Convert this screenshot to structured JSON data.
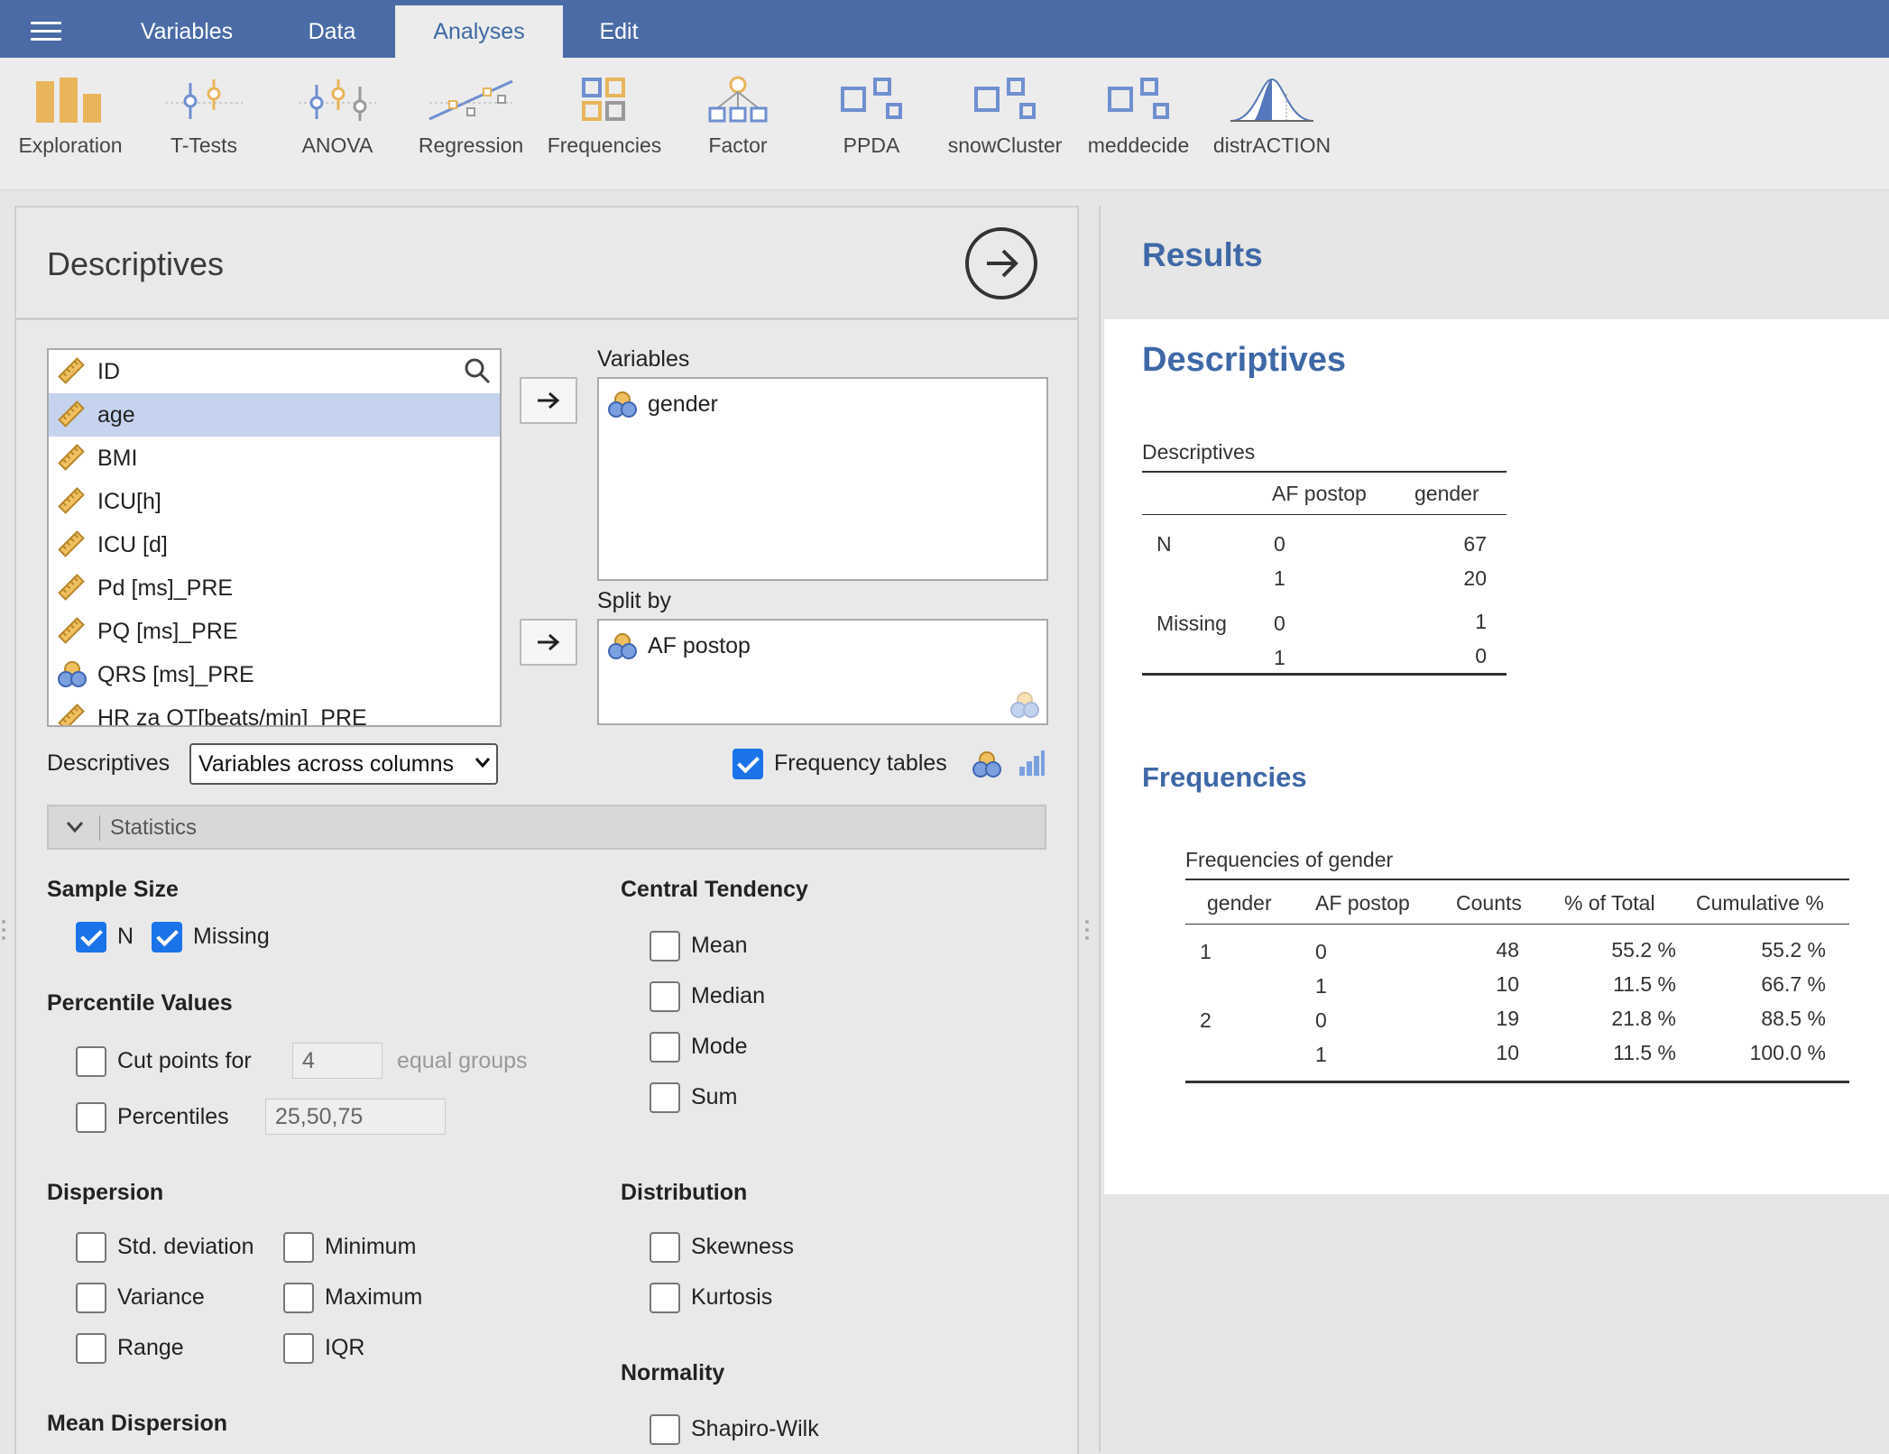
{
  "menu": {
    "tabs": [
      {
        "label": "Variables"
      },
      {
        "label": "Data"
      },
      {
        "label": "Analyses"
      },
      {
        "label": "Edit"
      }
    ],
    "active_tab": "Analyses"
  },
  "ribbon": {
    "items": [
      {
        "label": "Exploration",
        "icon": "exploration-icon"
      },
      {
        "label": "T-Tests",
        "icon": "ttests-icon"
      },
      {
        "label": "ANOVA",
        "icon": "anova-icon"
      },
      {
        "label": "Regression",
        "icon": "regression-icon"
      },
      {
        "label": "Frequencies",
        "icon": "frequencies-icon"
      },
      {
        "label": "Factor",
        "icon": "factor-icon"
      },
      {
        "label": "PPDA",
        "icon": "module-icon"
      },
      {
        "label": "snowCluster",
        "icon": "module-icon"
      },
      {
        "label": "meddecide",
        "icon": "module-icon"
      },
      {
        "label": "distrACTION",
        "icon": "distribution-icon"
      }
    ]
  },
  "options": {
    "title": "Descriptives",
    "variable_list": [
      {
        "name": "ID",
        "type": "continuous"
      },
      {
        "name": "age",
        "type": "continuous",
        "selected": true
      },
      {
        "name": "BMI",
        "type": "continuous"
      },
      {
        "name": "ICU[h]",
        "type": "continuous"
      },
      {
        "name": "ICU [d]",
        "type": "continuous"
      },
      {
        "name": "Pd [ms]_PRE",
        "type": "continuous"
      },
      {
        "name": "PQ [ms]_PRE",
        "type": "continuous"
      },
      {
        "name": "QRS [ms]_PRE",
        "type": "nominal"
      },
      {
        "name": "HR za OT[beats/min]_PRE",
        "type": "continuous"
      }
    ],
    "variables_label": "Variables",
    "variables": [
      "gender"
    ],
    "split_by_label": "Split by",
    "split_by": [
      "AF postop"
    ],
    "descriptives_label": "Descriptives",
    "descriptives_select": "Variables across columns",
    "frequency_tables_label": "Frequency tables",
    "frequency_tables_checked": true,
    "statistics_label": "Statistics",
    "sample_size": {
      "heading": "Sample Size",
      "n_label": "N",
      "n_checked": true,
      "missing_label": "Missing",
      "missing_checked": true
    },
    "percentile_values": {
      "heading": "Percentile Values",
      "cut_points_label": "Cut points for",
      "cut_points_value": "4",
      "equal_groups_label": "equal groups",
      "percentiles_label": "Percentiles",
      "percentiles_value": "25,50,75"
    },
    "dispersion": {
      "heading": "Dispersion",
      "std_deviation": "Std. deviation",
      "variance": "Variance",
      "range": "Range",
      "minimum": "Minimum",
      "maximum": "Maximum",
      "iqr": "IQR"
    },
    "mean_dispersion": {
      "heading": "Mean Dispersion"
    },
    "central_tendency": {
      "heading": "Central Tendency",
      "mean": "Mean",
      "median": "Median",
      "mode": "Mode",
      "sum": "Sum"
    },
    "distribution": {
      "heading": "Distribution",
      "skewness": "Skewness",
      "kurtosis": "Kurtosis"
    },
    "normality": {
      "heading": "Normality",
      "shapiro_wilk": "Shapiro-Wilk"
    }
  },
  "results": {
    "title": "Results",
    "section_title": "Descriptives",
    "descriptives_table": {
      "caption": "Descriptives",
      "headers": [
        "AF postop",
        "gender"
      ],
      "rows": [
        {
          "stat": "N",
          "af": "0",
          "value": "67"
        },
        {
          "stat": "",
          "af": "1",
          "value": "20"
        },
        {
          "stat": "Missing",
          "af": "0",
          "value": "1"
        },
        {
          "stat": "",
          "af": "1",
          "value": "0"
        }
      ]
    },
    "frequencies_title": "Frequencies",
    "frequencies_table": {
      "caption": "Frequencies of gender",
      "headers": [
        "gender",
        "AF postop",
        "Counts",
        "% of Total",
        "Cumulative %"
      ],
      "rows": [
        {
          "gender": "1",
          "af": "0",
          "counts": "48",
          "pct": "55.2 %",
          "cum": "55.2 %"
        },
        {
          "gender": "",
          "af": "1",
          "counts": "10",
          "pct": "11.5 %",
          "cum": "66.7 %"
        },
        {
          "gender": "2",
          "af": "0",
          "counts": "19",
          "pct": "21.8 %",
          "cum": "88.5 %"
        },
        {
          "gender": "",
          "af": "1",
          "counts": "10",
          "pct": "11.5 %",
          "cum": "100.0 %"
        }
      ]
    }
  },
  "colors": {
    "menu_bar": "#4a6ba6",
    "accent": "#3e68a6",
    "checkbox": "#1a73e8",
    "selected_row": "#c5d3ef"
  }
}
